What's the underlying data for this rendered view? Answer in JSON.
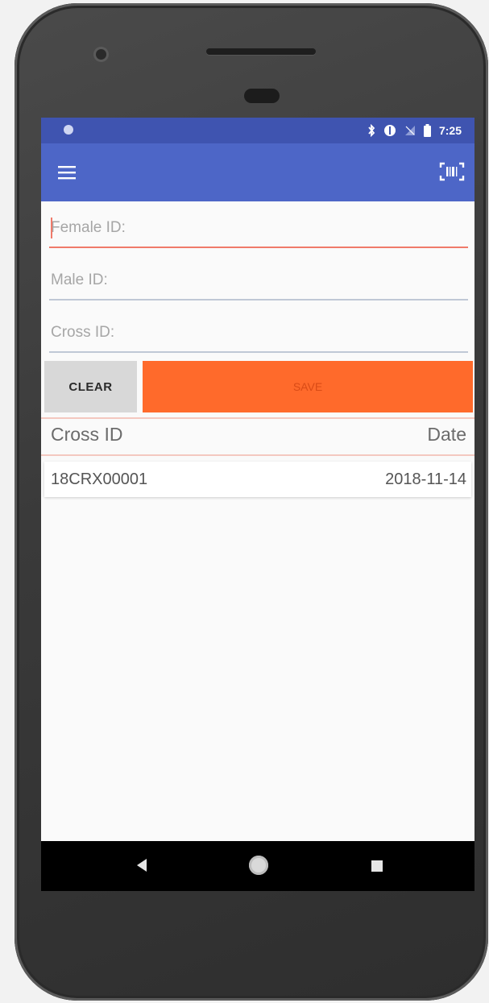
{
  "status_bar": {
    "time": "7:25"
  },
  "toolbar": {
    "menu_icon": "hamburger-menu-icon",
    "scan_icon": "barcode-scan-icon"
  },
  "form": {
    "female_id": {
      "placeholder": "Female ID:",
      "value": ""
    },
    "male_id": {
      "placeholder": "Male ID:",
      "value": ""
    },
    "cross_id": {
      "placeholder": "Cross ID:",
      "value": ""
    }
  },
  "buttons": {
    "clear_label": "CLEAR",
    "save_label": "SAVE"
  },
  "table": {
    "columns": [
      "Cross ID",
      "Date"
    ],
    "rows": [
      {
        "cross_id": "18CRX00001",
        "date": "2018-11-14"
      }
    ]
  },
  "colors": {
    "status_bar": "#3f54b0",
    "app_bar": "#4d66c7",
    "save_button": "#ff6a2b",
    "clear_button": "#d8d8d8",
    "active_underline": "#f07a6a"
  }
}
